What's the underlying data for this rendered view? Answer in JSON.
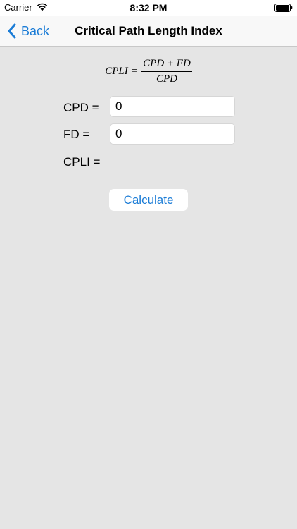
{
  "status_bar": {
    "carrier": "Carrier",
    "time": "8:32 PM",
    "icons": [
      "wifi-icon",
      "battery-icon"
    ]
  },
  "nav": {
    "back_label": "Back",
    "title": "Critical Path Length Index",
    "accent_color": "#1b7cd6"
  },
  "formula": {
    "lhs": "CPLI",
    "equals": "=",
    "numerator": "CPD + FD",
    "denominator": "CPD"
  },
  "form": {
    "cpd_label": "CPD =",
    "cpd_value": "0",
    "fd_label": "FD =",
    "fd_value": "0",
    "cpli_label": "CPLI  =",
    "cpli_result": ""
  },
  "actions": {
    "calculate_label": "Calculate"
  },
  "colors": {
    "background": "#e5e5e5",
    "nav_background": "#f8f8f8",
    "field_background": "#ffffff"
  }
}
